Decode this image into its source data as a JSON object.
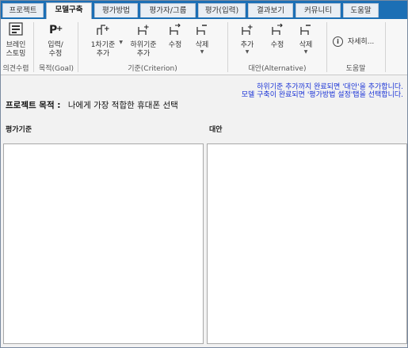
{
  "tabs": [
    {
      "label": "프로젝트"
    },
    {
      "label": "모델구축"
    },
    {
      "label": "평가방법"
    },
    {
      "label": "평가자/그룹"
    },
    {
      "label": "평가(입력)"
    },
    {
      "label": "결과보기"
    },
    {
      "label": "커뮤니티"
    },
    {
      "label": "도움말"
    }
  ],
  "active_tab": "모델구축",
  "ribbon": {
    "brainstorm": {
      "line1": "브레인",
      "line2": "스토밍",
      "group": "의견수렴"
    },
    "goal": {
      "line1": "입력/",
      "line2": "수정",
      "group": "목적(Goal)"
    },
    "criterion": {
      "add_first": {
        "line1": "1차기준",
        "line2": "추가"
      },
      "add_sub": {
        "line1": "하위기준",
        "line2": "추가"
      },
      "edit": "수정",
      "delete": "삭제",
      "group": "기준(Criterion)"
    },
    "alternative": {
      "add": "추가",
      "edit": "수정",
      "delete": "삭제",
      "group": "대안(Alternative)"
    },
    "help": {
      "details": "자세히...",
      "group": "도움말"
    }
  },
  "main": {
    "hint_line1": "하위기준 추가까지 완료되면 '대안'을 추가합니다.",
    "hint_line2": "모델 구축이 완료되면 '평가방법 설정'탭을 선택합니다.",
    "goal_label": "프로젝트 목적 :",
    "goal_value": "나에게 가장 적합한 휴대폰 선택",
    "criteria_title": "평가기준",
    "alternatives_title": "대안"
  },
  "colors": {
    "tabbar": "#1c6fb5",
    "hint": "#1a33d6"
  }
}
